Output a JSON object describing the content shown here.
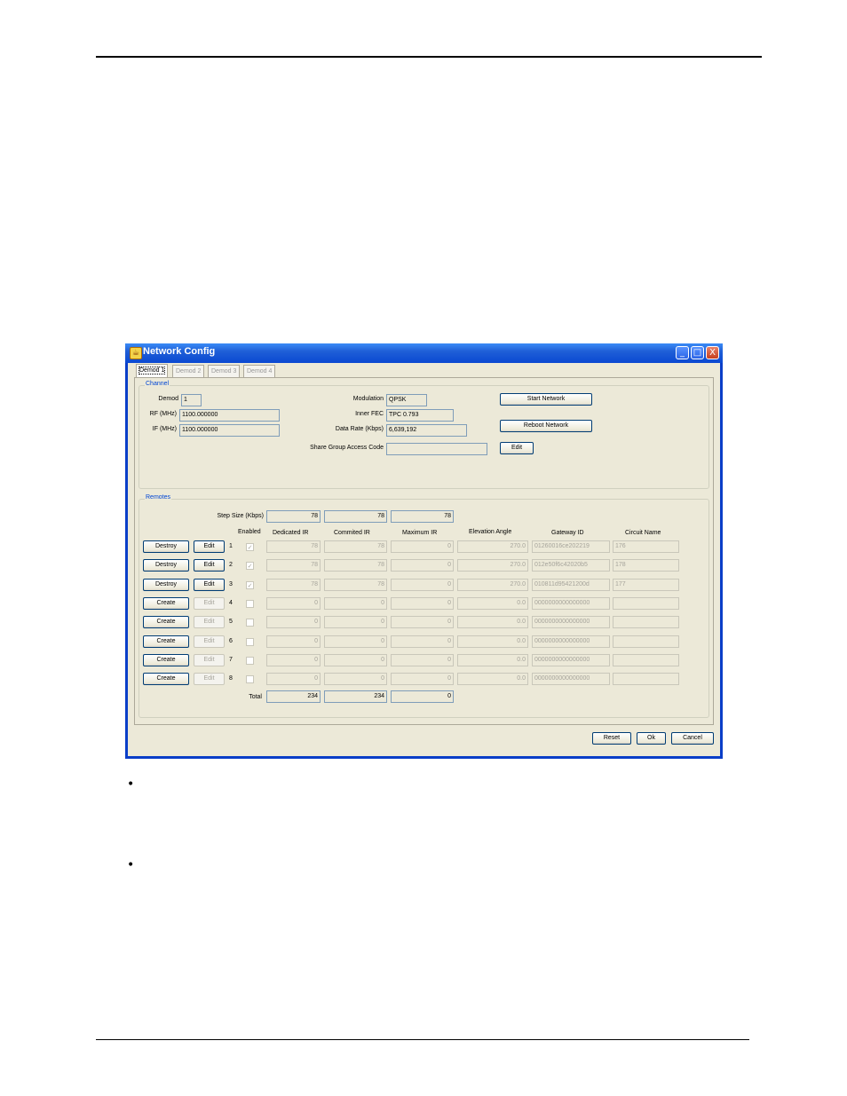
{
  "window": {
    "title": "Network Config",
    "minimize_glyph": "_",
    "maximize_glyph": "□",
    "close_glyph": "X"
  },
  "tabs": [
    "Demod 1",
    "Demod 2",
    "Demod 3",
    "Demod 4"
  ],
  "channel": {
    "group_label": "Channel",
    "demod_label": "Demod",
    "demod_value": "1",
    "rf_label": "RF (MHz)",
    "rf_value": "1100.000000",
    "if_label": "IF (MHz)",
    "if_value": "1100.000000",
    "modulation_label": "Modulation",
    "modulation_value": "QPSK",
    "inner_fec_label": "Inner FEC",
    "inner_fec_value": "TPC 0.793",
    "data_rate_label": "Data Rate (Kbps)",
    "data_rate_value": "6,639,192",
    "share_group_label": "Share Group Access Code",
    "share_group_value": "",
    "start_network_button": "Start Network",
    "reboot_network_button": "Reboot Network",
    "edit_button": "Edit"
  },
  "remotes": {
    "group_label": "Remotes",
    "step_size_label": "Step Size (Kbps)",
    "step_sizes": [
      "78",
      "78",
      "78"
    ],
    "columns": {
      "enabled": "Enabled",
      "dedicated_ir": "Dedicated IR",
      "committed_ir": "Commited IR",
      "maximum_ir": "Maximum IR",
      "elevation_angle": "Elevation Angle",
      "gateway_id": "Gateway ID",
      "circuit_name": "Circuit Name"
    },
    "rows": [
      {
        "action": "Destroy",
        "edit": "Edit",
        "index": "1",
        "checked": "✓",
        "dedicated": "78",
        "committed": "78",
        "maximum": "0",
        "elevation": "270.0",
        "gateway": "01260016ce202219",
        "circuit": "176"
      },
      {
        "action": "Destroy",
        "edit": "Edit",
        "index": "2",
        "checked": "✓",
        "dedicated": "78",
        "committed": "78",
        "maximum": "0",
        "elevation": "270.0",
        "gateway": "012e50f6c42020b5",
        "circuit": "178"
      },
      {
        "action": "Destroy",
        "edit": "Edit",
        "index": "3",
        "checked": "✓",
        "dedicated": "78",
        "committed": "78",
        "maximum": "0",
        "elevation": "270.0",
        "gateway": "010811d95421200d",
        "circuit": "177"
      },
      {
        "action": "Create",
        "edit": "Edit",
        "index": "4",
        "checked": "",
        "dedicated": "0",
        "committed": "0",
        "maximum": "0",
        "elevation": "0.0",
        "gateway": "0000000000000000",
        "circuit": ""
      },
      {
        "action": "Create",
        "edit": "Edit",
        "index": "5",
        "checked": "",
        "dedicated": "0",
        "committed": "0",
        "maximum": "0",
        "elevation": "0.0",
        "gateway": "0000000000000000",
        "circuit": ""
      },
      {
        "action": "Create",
        "edit": "Edit",
        "index": "6",
        "checked": "",
        "dedicated": "0",
        "committed": "0",
        "maximum": "0",
        "elevation": "0.0",
        "gateway": "0000000000000000",
        "circuit": ""
      },
      {
        "action": "Create",
        "edit": "Edit",
        "index": "7",
        "checked": "",
        "dedicated": "0",
        "committed": "0",
        "maximum": "0",
        "elevation": "0.0",
        "gateway": "0000000000000000",
        "circuit": ""
      },
      {
        "action": "Create",
        "edit": "Edit",
        "index": "8",
        "checked": "",
        "dedicated": "0",
        "committed": "0",
        "maximum": "0",
        "elevation": "0.0",
        "gateway": "0000000000000000",
        "circuit": ""
      }
    ],
    "total_label": "Total",
    "totals": [
      "234",
      "234",
      "0"
    ]
  },
  "footer": {
    "reset_button": "Reset",
    "ok_button": "Ok",
    "cancel_button": "Cancel"
  },
  "document": {
    "bullet_glyph": "•"
  }
}
